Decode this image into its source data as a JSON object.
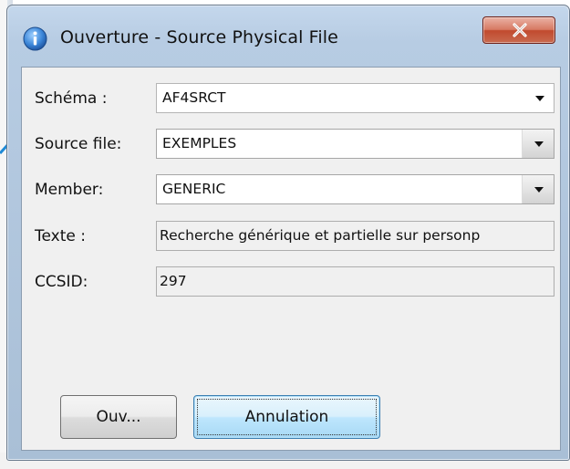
{
  "window": {
    "title": "Ouverture - Source Physical File",
    "close_symbol": "X"
  },
  "form": {
    "schema": {
      "label": "Schéma :",
      "value": "AF4SRCT"
    },
    "source_file": {
      "label": "Source file:",
      "value": "EXEMPLES"
    },
    "member": {
      "label": "Member:",
      "value": "GENERIC"
    },
    "texte": {
      "label": "Texte :",
      "value": "Recherche générique et partielle sur personp"
    },
    "ccsid": {
      "label": "CCSID:",
      "value": "297"
    }
  },
  "buttons": {
    "open_label": "Ouv...",
    "cancel_label": "Annulation"
  },
  "icons": {
    "app": "info-icon",
    "close": "close-icon",
    "dropdown": "chevron-down-icon"
  },
  "colors": {
    "title_bar": "#b9cde4",
    "close_button": "#c9573a",
    "default_button": "#bee6fd",
    "client_bg": "#f0f0f0"
  }
}
